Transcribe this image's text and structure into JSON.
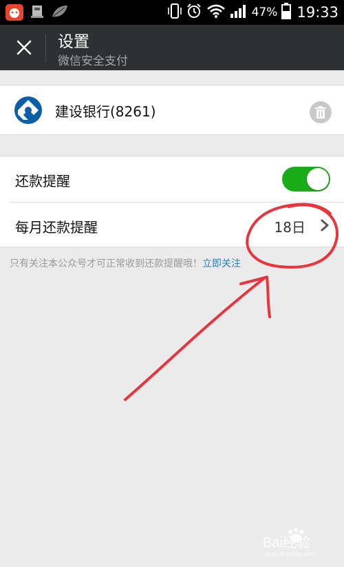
{
  "status_bar": {
    "battery_percent": "47%",
    "time": "19:33",
    "icons": [
      "app-icon",
      "app-icon",
      "leaf-icon",
      "phone-vibrate-icon",
      "alarm-icon",
      "wifi-icon",
      "signal-icon",
      "battery-icon"
    ]
  },
  "app_bar": {
    "title": "设置",
    "subtitle": "微信安全支付",
    "close_icon": "close-icon"
  },
  "bank_card": {
    "name": "建设银行(8261)",
    "logo_icon": "ccb-logo-icon",
    "delete_icon": "trash-icon"
  },
  "settings": {
    "repayment_reminder": {
      "label": "还款提醒",
      "enabled": true
    },
    "monthly_reminder": {
      "label": "每月还款提醒",
      "value": "18日",
      "chevron_icon": "chevron-right-icon"
    }
  },
  "notice": {
    "text": "只有关注本公众号才可正常收到还款提醒哦！",
    "link": "立即关注"
  },
  "watermark": {
    "text": "Bai经验",
    "sub": "jingyan.baidu.com"
  },
  "colors": {
    "toolbar": "#2d3132",
    "accent_green": "#1aad19",
    "link": "#2f7db8",
    "annotation": "#e8343c"
  }
}
